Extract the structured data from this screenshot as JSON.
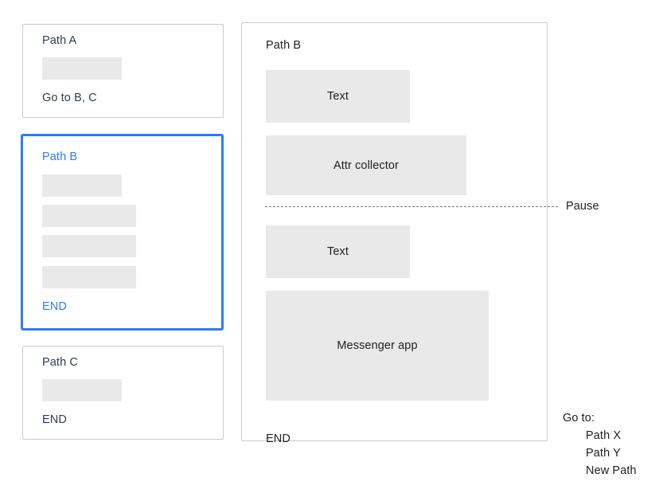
{
  "colors": {
    "accent_blue": "#2b7cf7",
    "card_border": "#c8ccd0",
    "placeholder_grey": "#e9e9e9",
    "text_slate": "#2c3e50",
    "text_dark": "#202124",
    "dash_grey": "#7c7c7c",
    "background": "#ffffff"
  },
  "left_column": {
    "cards": [
      {
        "title": "Path A",
        "placeholder_count": 1,
        "footer": "Go to B, C",
        "selected": false
      },
      {
        "title": "Path B",
        "placeholder_count": 4,
        "footer": "END",
        "selected": true
      },
      {
        "title": "Path C",
        "placeholder_count": 1,
        "footer": "END",
        "selected": false
      }
    ]
  },
  "main_panel": {
    "title": "Path B",
    "blocks": [
      {
        "label": "Text"
      },
      {
        "label": "Attr collector"
      },
      {
        "label": "Text"
      },
      {
        "label": "Messenger app"
      }
    ],
    "footer": "END"
  },
  "pause_divider": {
    "label": "Pause"
  },
  "goto": {
    "heading": "Go to:",
    "items": [
      "Path X",
      "Path Y",
      "New Path"
    ]
  }
}
